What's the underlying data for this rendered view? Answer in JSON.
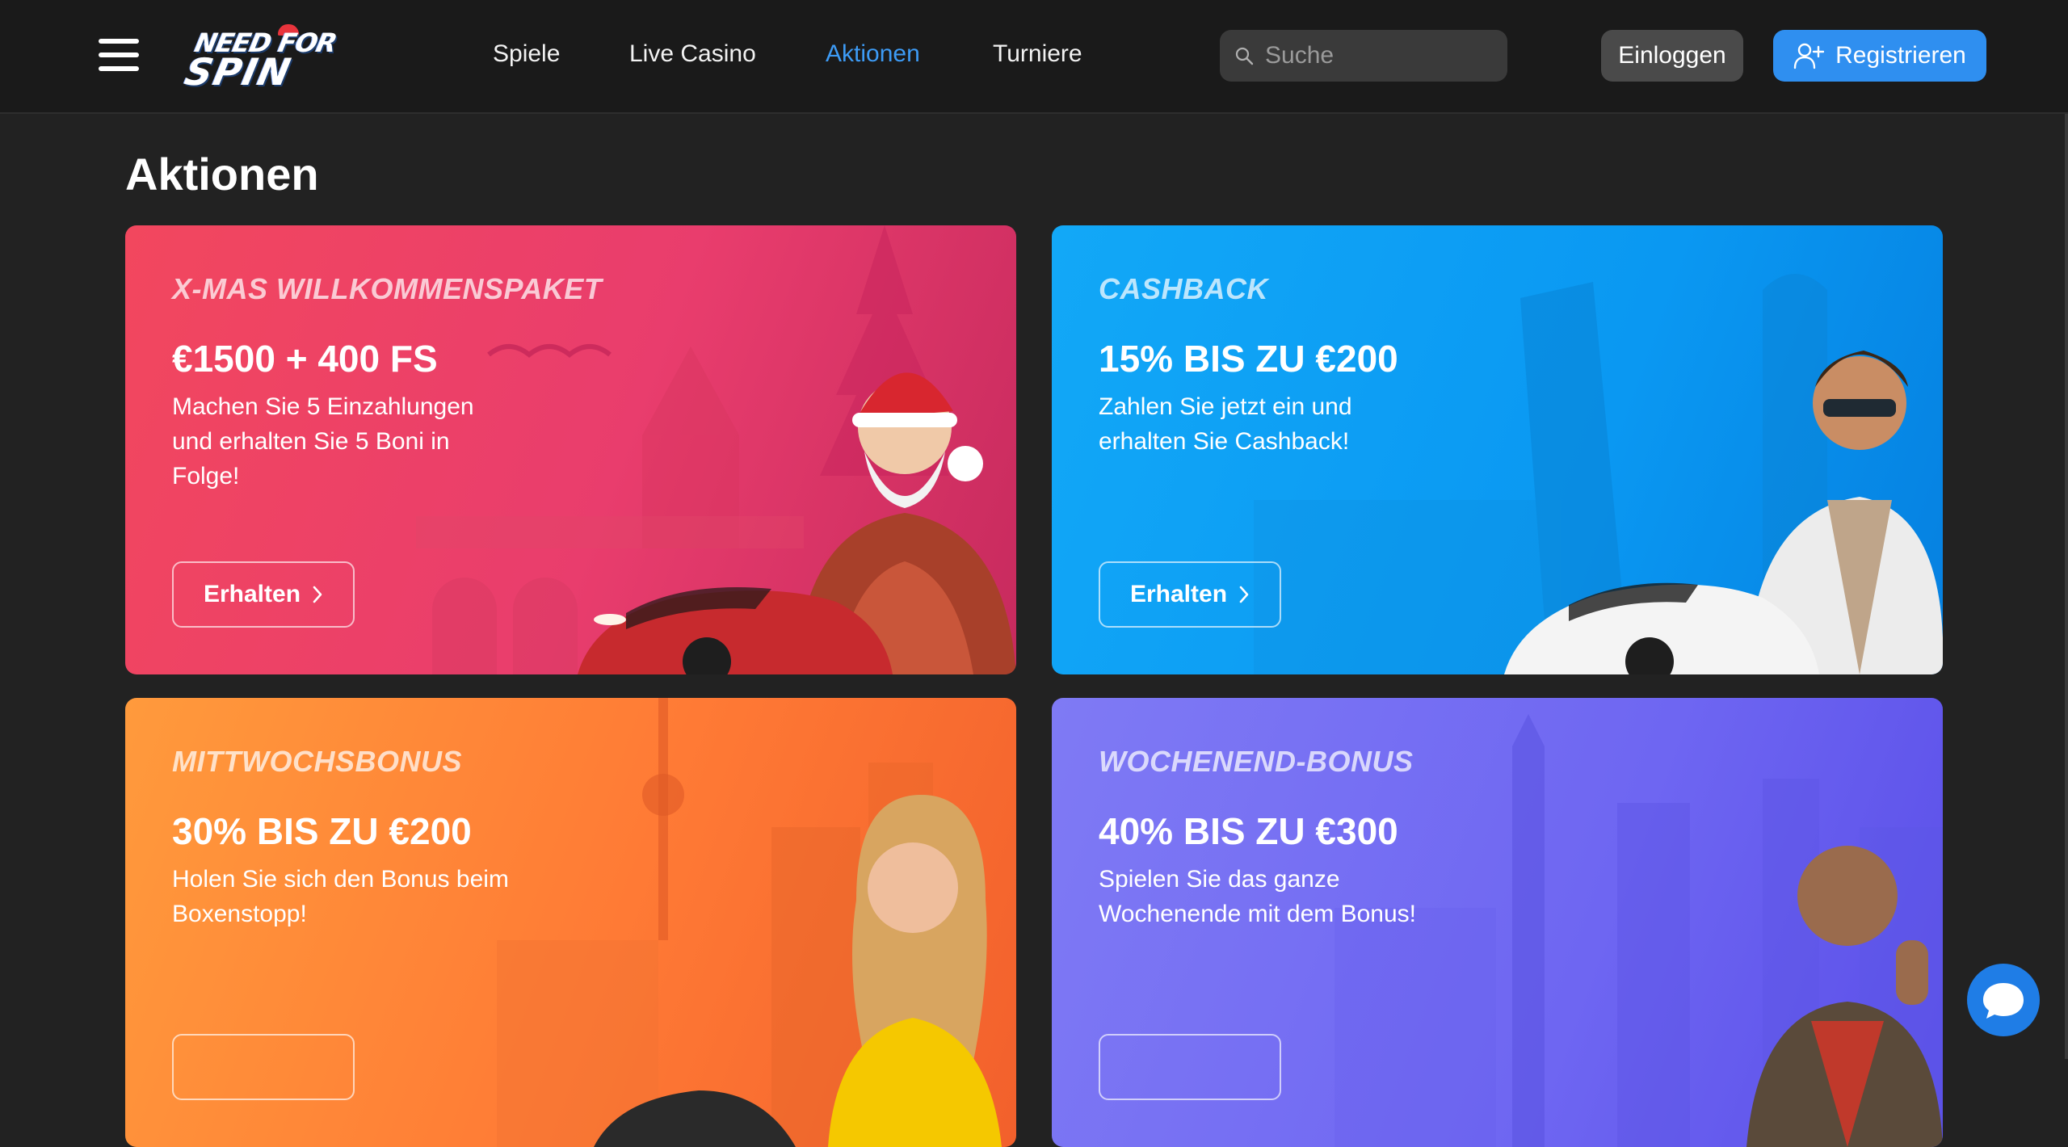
{
  "header": {
    "logo_line1": "NEED FOR",
    "logo_line2": "SPIN",
    "nav": [
      {
        "label": "Spiele"
      },
      {
        "label": "Live Casino"
      },
      {
        "label": "Aktionen"
      },
      {
        "label": "Turniere"
      }
    ],
    "search_placeholder": "Suche",
    "login_label": "Einloggen",
    "register_label": "Registrieren"
  },
  "page_title": "Aktionen",
  "cards": [
    {
      "kicker": "X-MAS WILLKOMMENSPAKET",
      "headline": "€1500 + 400 FS",
      "desc": "Machen Sie 5 Einzahlungen und erhalten Sie 5 Boni in Folge!",
      "cta": "Erhalten"
    },
    {
      "kicker": "CASHBACK",
      "headline": "15% BIS ZU €200",
      "desc": "Zahlen Sie jetzt ein und erhalten Sie Cashback!",
      "cta": "Erhalten"
    },
    {
      "kicker": "MITTWOCHSBONUS",
      "headline": "30% BIS ZU €200",
      "desc": "Holen Sie sich den Bonus beim Boxenstopp!",
      "cta": ""
    },
    {
      "kicker": "WOCHENEND-BONUS",
      "headline": "40% BIS ZU €300",
      "desc": "Spielen Sie das ganze Wochenende mit dem Bonus!",
      "cta": ""
    }
  ],
  "colors": {
    "accent": "#3d9bf5",
    "register_bg": "#2f8ff0",
    "header_bg": "#1a1a1a",
    "page_bg": "#222222",
    "card_xmas": "#e93d6d",
    "card_cashback": "#0a98f2",
    "card_wednesday": "#ff7a35",
    "card_weekend": "#6e66f2"
  },
  "icons": {
    "menu": "hamburger-icon",
    "search": "search-icon",
    "register": "user-plus-icon",
    "cta": "chevron-right-icon",
    "chat": "chat-bubble-icon"
  }
}
